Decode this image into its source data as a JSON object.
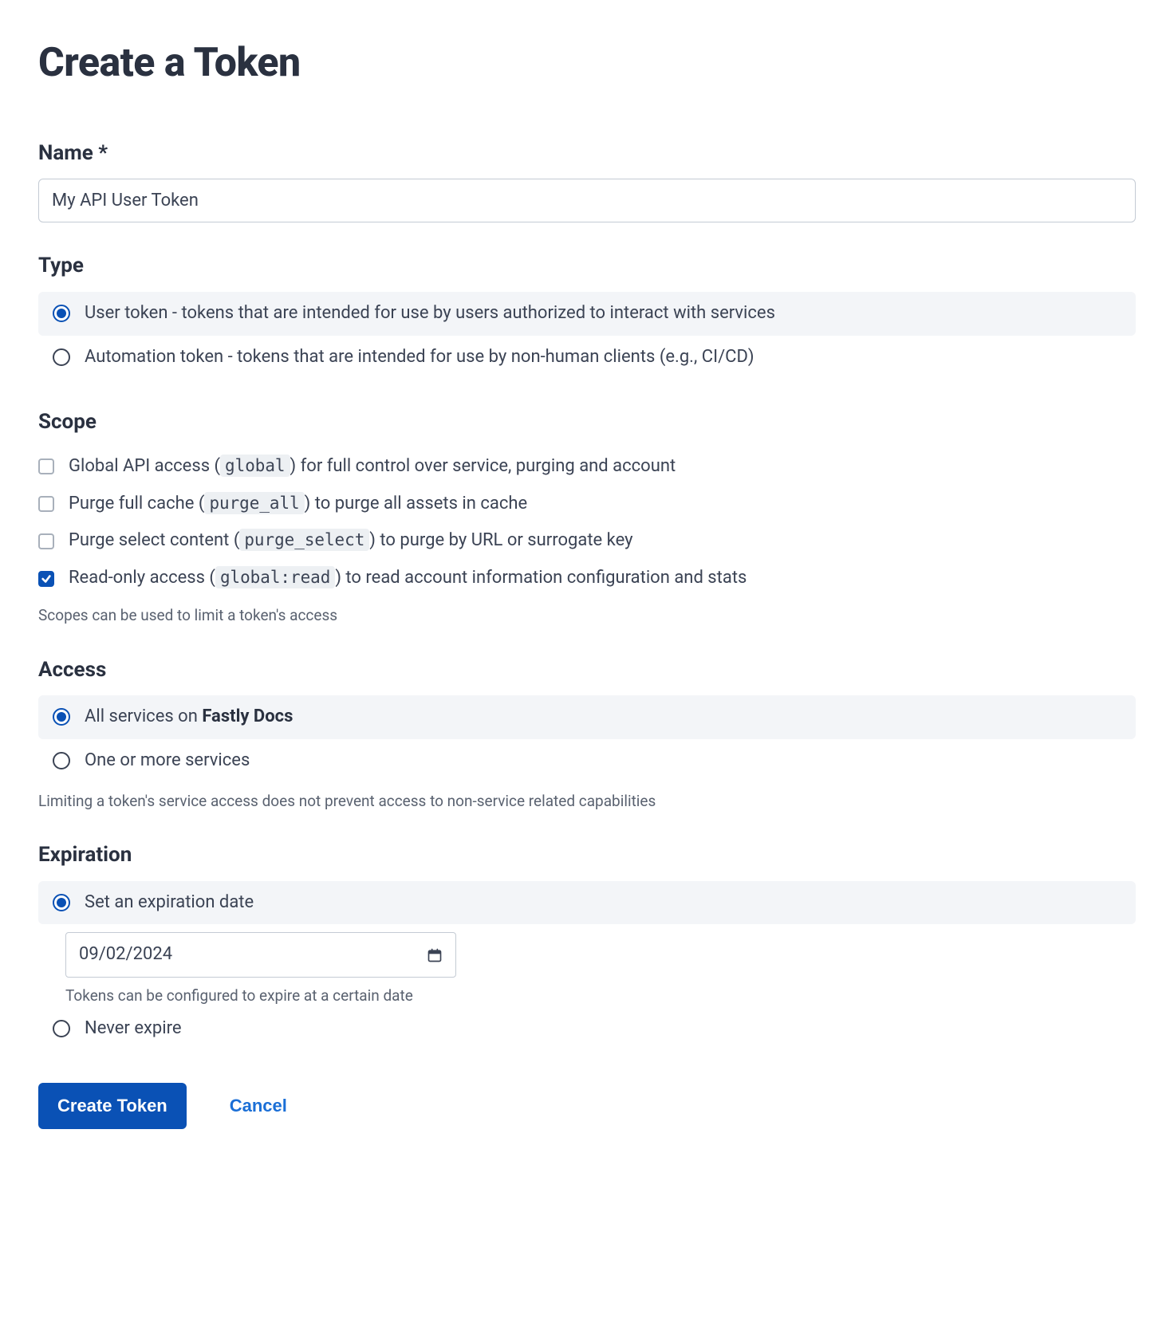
{
  "title": "Create a Token",
  "name": {
    "label": "Name *",
    "value": "My API User Token"
  },
  "type": {
    "label": "Type",
    "options": [
      {
        "label": "User token - tokens that are intended for use by users authorized to interact with services",
        "selected": true
      },
      {
        "label": "Automation token - tokens that are intended for use by non-human clients (e.g., CI/CD)",
        "selected": false
      }
    ]
  },
  "scope": {
    "label": "Scope",
    "help": "Scopes can be used to limit a token's access",
    "options": [
      {
        "pre": "Global API access (",
        "code": "global",
        "post": ") for full control over service, purging and account",
        "checked": false
      },
      {
        "pre": "Purge full cache (",
        "code": "purge_all",
        "post": ") to purge all assets in cache",
        "checked": false
      },
      {
        "pre": "Purge select content (",
        "code": "purge_select",
        "post": ") to purge by URL or surrogate key",
        "checked": false
      },
      {
        "pre": "Read-only access (",
        "code": "global:read",
        "post": ") to read account information configuration and stats",
        "checked": true
      }
    ]
  },
  "access": {
    "label": "Access",
    "help": "Limiting a token's service access does not prevent access to non-service related capabilities",
    "all_prefix": "All services on ",
    "account_name": "Fastly Docs",
    "options": [
      {
        "selected": true
      },
      {
        "label": "One or more services",
        "selected": false
      }
    ]
  },
  "expiration": {
    "label": "Expiration",
    "set_label": "Set an expiration date",
    "never_label": "Never expire",
    "date_value": "09/02/2024",
    "date_help": "Tokens can be configured to expire at a certain date",
    "set_selected": true,
    "never_selected": false
  },
  "buttons": {
    "submit": "Create Token",
    "cancel": "Cancel"
  }
}
